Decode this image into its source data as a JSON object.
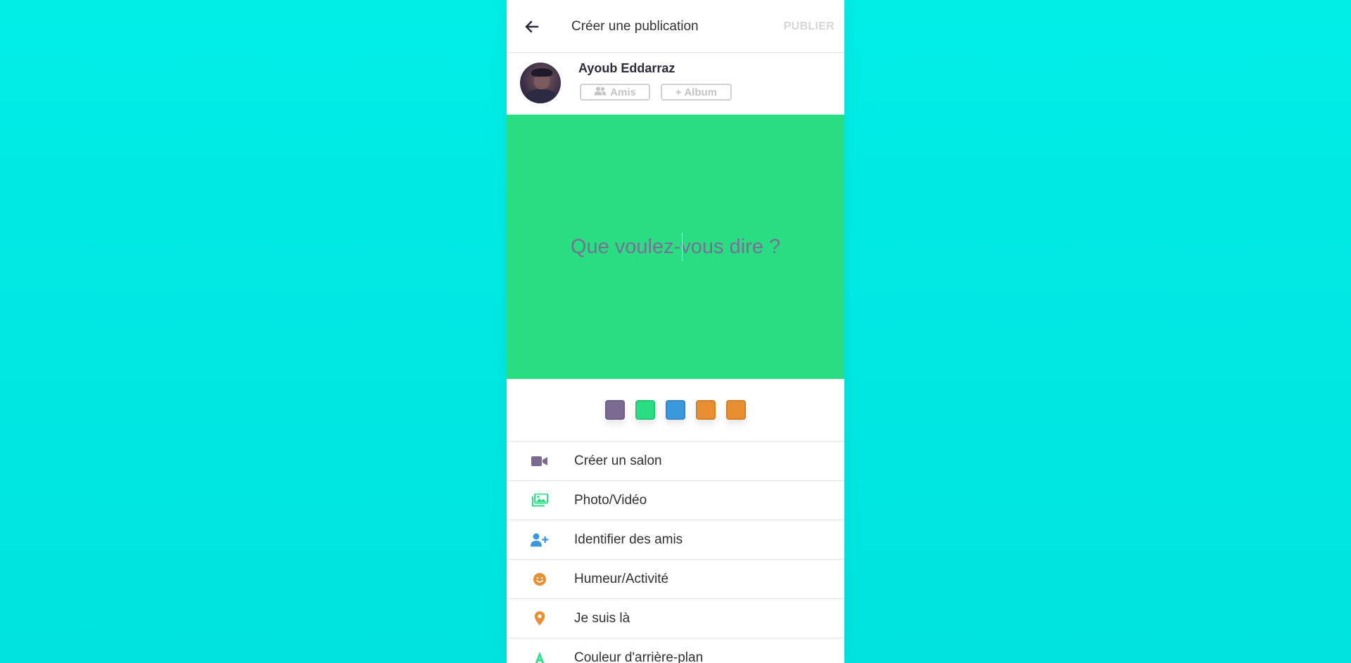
{
  "header": {
    "title": "Créer une publication",
    "publish_label": "PUBLIER"
  },
  "user": {
    "name": "Ayoub Eddarraz",
    "audience_label": "Amis",
    "album_label": "+ Album"
  },
  "composer": {
    "placeholder": "Que voulez-vous dire ?",
    "background_color": "#28dd82"
  },
  "swatches": [
    {
      "color": "#7b6b93"
    },
    {
      "color": "#28dd82"
    },
    {
      "color": "#3a98dc"
    },
    {
      "color": "#e88f32"
    },
    {
      "color": "#e88f32"
    }
  ],
  "options": [
    {
      "label": "Créer un salon",
      "icon": "video-camera-icon",
      "color": "#7b6b93"
    },
    {
      "label": "Photo/Vidéo",
      "icon": "images-icon",
      "color": "#28dd82"
    },
    {
      "label": "Identifier des amis",
      "icon": "user-plus-icon",
      "color": "#3a98dc"
    },
    {
      "label": "Humeur/Activité",
      "icon": "smiley-icon",
      "color": "#e88f32"
    },
    {
      "label": "Je suis là",
      "icon": "map-pin-icon",
      "color": "#e88f32"
    },
    {
      "label": "Couleur d'arrière-plan",
      "icon": "text-color-icon",
      "color": "#28dd82"
    }
  ]
}
